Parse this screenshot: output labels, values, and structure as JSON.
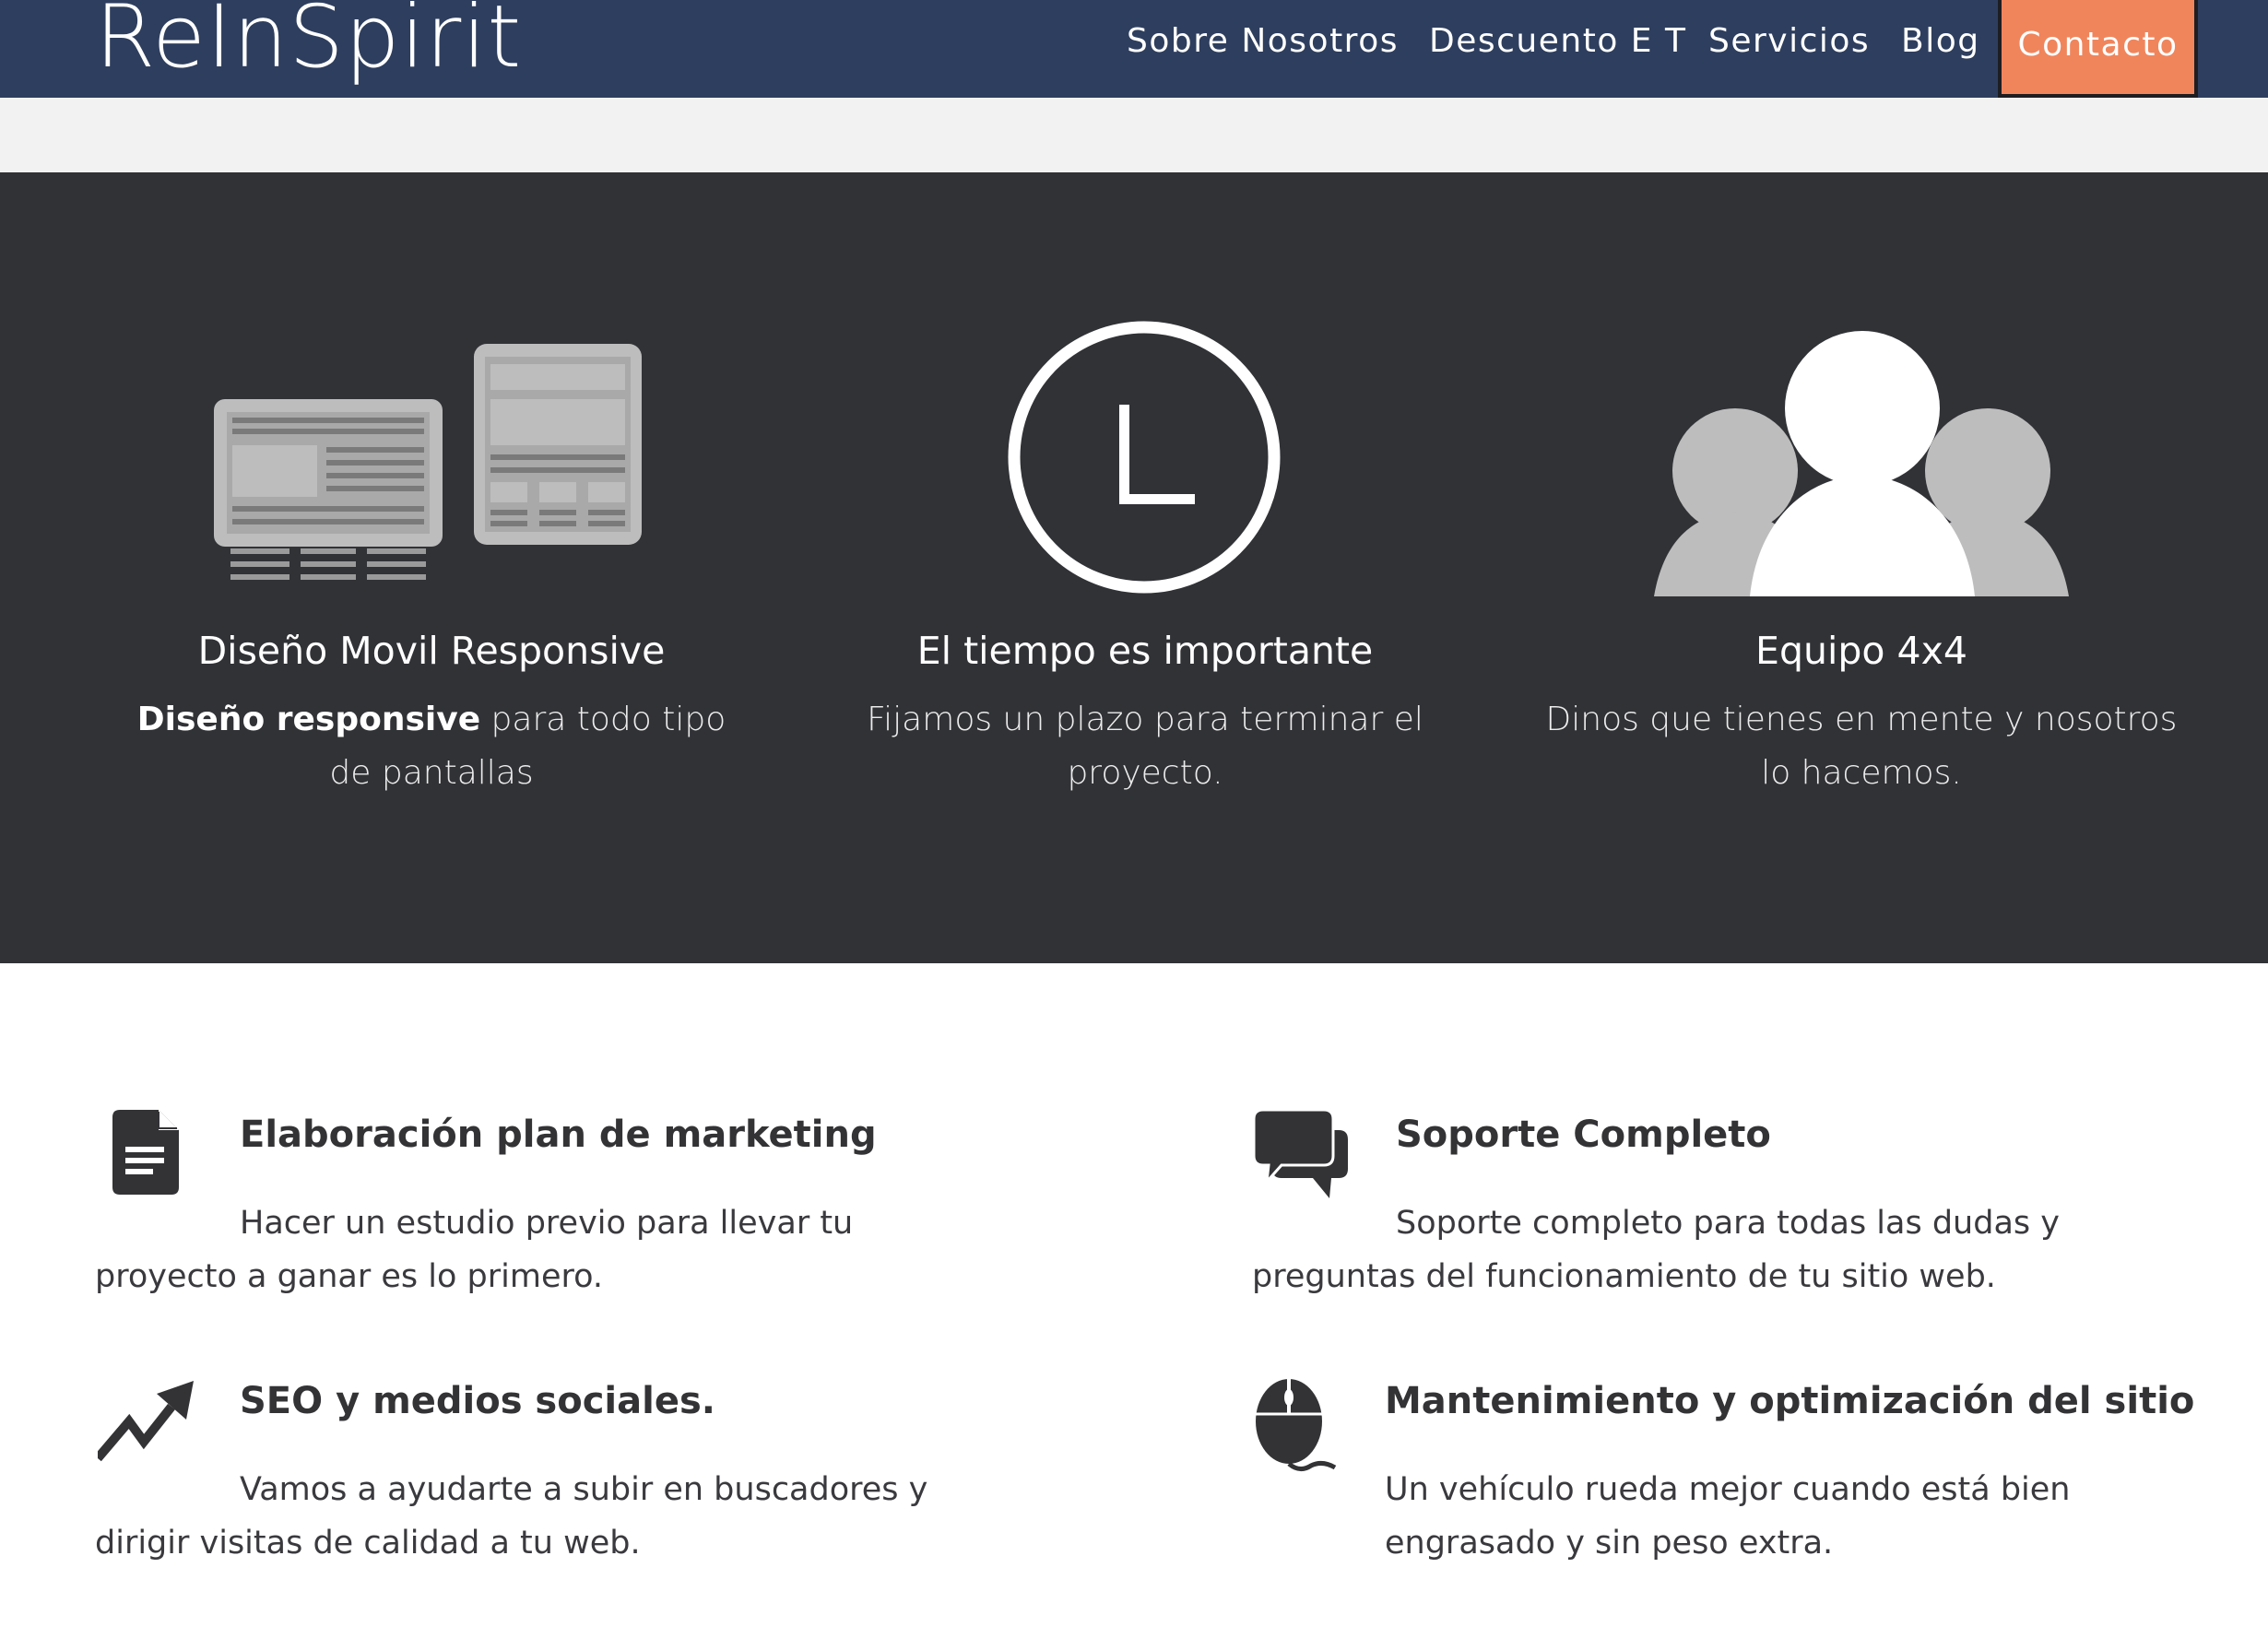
{
  "header": {
    "logo": "ReInSpirit",
    "nav": [
      {
        "label": "Sobre Nosotros"
      },
      {
        "label": "Descuento E T"
      },
      {
        "label": "Servicios"
      },
      {
        "label": "Blog"
      }
    ],
    "contact_label": "Contacto"
  },
  "features": [
    {
      "icon": "responsive-devices-icon",
      "title": "Diseño Movil Responsive",
      "desc_bold": "Diseño responsive",
      "desc": " para todo tipo de pantallas"
    },
    {
      "icon": "clock-icon",
      "title": "El tiempo es importante",
      "desc": "Fijamos un plazo para terminar el proyecto."
    },
    {
      "icon": "team-icon",
      "title": "Equipo 4x4",
      "desc": "Dinos que tienes en mente y nosotros lo hacemos."
    }
  ],
  "services": [
    {
      "icon": "document-icon",
      "title": "Elaboración plan de marketing",
      "desc": "Hacer un estudio previo para llevar tu proyecto a ganar es lo primero."
    },
    {
      "icon": "chat-bubbles-icon",
      "title": "Soporte Completo",
      "desc": "Soporte completo para todas las dudas y preguntas del funcionamiento de tu sitio web."
    },
    {
      "icon": "trending-up-icon",
      "title": "SEO y medios sociales.",
      "desc": "Vamos a ayudarte a subir en buscadores y dirigir visitas de calidad a tu web."
    },
    {
      "icon": "mouse-icon",
      "title": "Mantenimiento y optimización del sitio",
      "desc": "Un vehículo rueda mejor cuando está bien engrasado y sin peso extra."
    }
  ],
  "colors": {
    "header_bg": "#2e3e5e",
    "contact_bg": "#f0855c",
    "dark_band": "#313236",
    "strip": "#f2f2f2",
    "text": "#333336"
  }
}
